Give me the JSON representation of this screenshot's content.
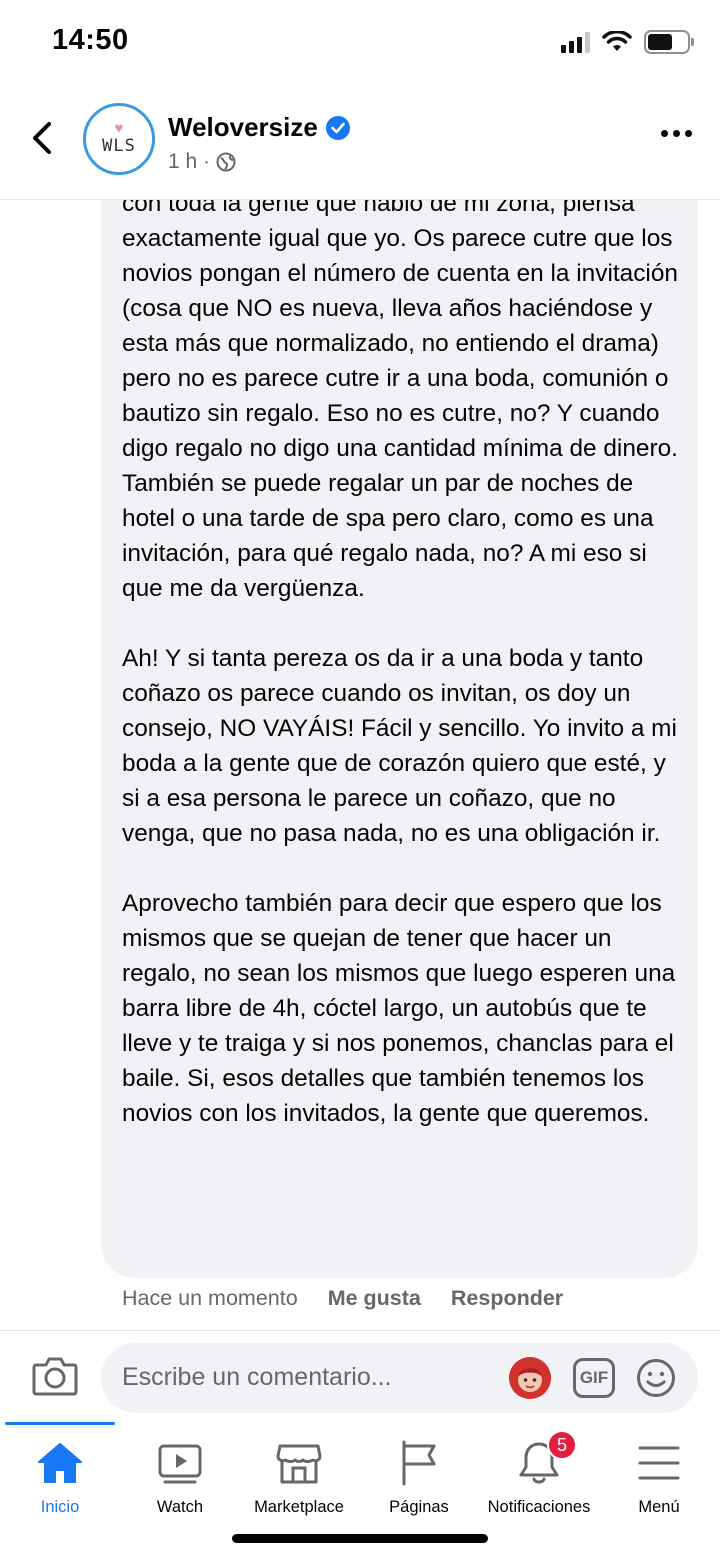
{
  "status_bar": {
    "time": "14:50"
  },
  "header": {
    "page_name": "Weloversize",
    "avatar_heart": "♥",
    "avatar_text": "WLS",
    "post_time": "1 h ·",
    "icons": [
      "back-arrow-icon",
      "verified-badge-icon",
      "globe-icon",
      "more-icon"
    ]
  },
  "comment": {
    "paragraphs": [
      "con toda la gente que habló de mi zona, piensa exactamente igual que yo. Os parece cutre que los novios pongan el número de cuenta en la invitación (cosa que NO es nueva, lleva años haciéndose y esta más que normalizado, no entiendo el drama) pero no es parece cutre ir a una boda, comunión o bautizo sin regalo. Eso no es cutre, no? Y cuando digo regalo no digo una cantidad mínima de dinero. También se puede regalar un par de noches de hotel o una tarde de spa pero claro, como es una invitación, para qué regalo nada, no? A mi eso si que me da vergüenza.",
      "Ah! Y si tanta pereza os da ir a una boda y tanto coñazo os parece cuando os invitan, os doy un consejo, NO VAYÁIS! Fácil y sencillo. Yo invito a mi boda a la gente que de corazón quiero que esté, y si a esa persona le parece un coñazo, que no venga, que no pasa nada, no es una obligación ir.",
      "Aprovecho también para decir que espero que los mismos que se quejan de tener que hacer un regalo, no sean los mismos que luego esperen una barra libre de 4h, cóctel largo, un autobús que te lleve y te traiga y si nos ponemos, chanclas para el baile. Si, esos detalles que también tenemos los novios con los invitados, la gente que queremos."
    ],
    "time": "Hace un momento",
    "like_label": "Me gusta",
    "reply_label": "Responder"
  },
  "composer": {
    "placeholder": "Escribe un comentario...",
    "gif_label": "GIF",
    "icons": [
      "camera-icon",
      "avatar-sticker-icon",
      "gif-icon",
      "emoji-icon"
    ]
  },
  "tabs": [
    {
      "label": "Inicio",
      "icon": "home-icon",
      "active": true
    },
    {
      "label": "Watch",
      "icon": "watch-icon",
      "active": false
    },
    {
      "label": "Marketplace",
      "icon": "marketplace-icon",
      "active": false
    },
    {
      "label": "Páginas",
      "icon": "flag-icon",
      "active": false
    },
    {
      "label": "Notificaciones",
      "icon": "bell-icon",
      "active": false,
      "badge": "5"
    },
    {
      "label": "Menú",
      "icon": "menu-icon",
      "active": false
    }
  ],
  "colors": {
    "accent": "#1877f2",
    "bubble": "#f0f2f5",
    "secondary_text": "#65676b",
    "badge": "#e41e3f"
  }
}
